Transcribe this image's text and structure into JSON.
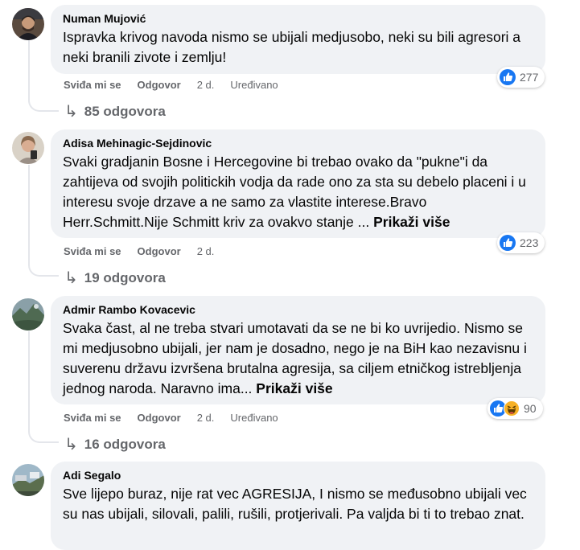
{
  "comments": [
    {
      "author": "Numan Mujović",
      "text": "Ispravka krivog navoda nismo se ubijali medjusobo, neki su bili agresori a neki branili zivote i zemlju!",
      "more": "",
      "actions": {
        "like": "Sviđa mi se",
        "reply": "Odgovor",
        "time": "2 d.",
        "edited": "Uređivano"
      },
      "reaction_count": "277",
      "replies": "85 odgovora"
    },
    {
      "author": "Adisa Mehinagic-Sejdinovic",
      "text": "Svaki gradjanin Bosne i Hercegovine bi trebao ovako da \"pukne\"i da zahtijeva od svojih politickih vodja da rade ono za sta su debelo placeni i u interesu svoje drzave a ne samo za vlastite interese.Bravo Herr.Schmitt.Nije Schmitt kriv za ovakvo stanje ...",
      "more": "Prikaži više",
      "actions": {
        "like": "Sviđa mi se",
        "reply": "Odgovor",
        "time": "2 d.",
        "edited": ""
      },
      "reaction_count": "223",
      "replies": "19 odgovora"
    },
    {
      "author": "Admir Rambo Kovacevic",
      "text": "Svaka čast, al ne treba stvari umotavati da se ne bi ko uvrijedio. Nismo se mi medjusobno ubijali, jer nam je dosadno, nego je na BiH kao nezavisnu i suverenu državu izvršena brutalna agresija, sa ciljem etničkog istrebljenja jednog naroda. Naravno ima...",
      "more": "Prikaži više",
      "actions": {
        "like": "Sviđa mi se",
        "reply": "Odgovor",
        "time": "2 d.",
        "edited": "Uređivano"
      },
      "reaction_count": "90",
      "replies": "16 odgovora"
    },
    {
      "author": "Adi Segalo",
      "text": "Sve lijepo buraz, nije rat vec AGRESIJA, I nismo se međusobno ubijali vec su nas ubijali, silovali, palili, rušili, protjerivali. Pa valjda bi ti to trebao znat.",
      "more": "",
      "actions": {
        "like": "",
        "reply": "",
        "time": "",
        "edited": ""
      },
      "reaction_count": "",
      "replies": ""
    }
  ],
  "icons": {
    "like": "like-reaction-icon",
    "haha": "haha-reaction-icon",
    "reply_arrow": "reply-arrow-icon"
  },
  "colors": {
    "like_blue": "#1877f2",
    "haha_yellow": "#f7b125",
    "meta_gray": "#65676b",
    "bubble_bg": "#f0f2f5"
  }
}
